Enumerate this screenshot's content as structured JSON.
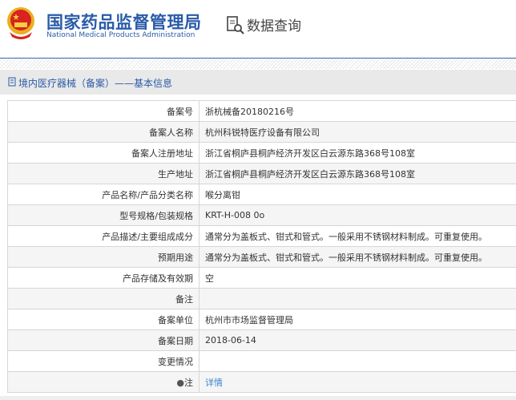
{
  "header": {
    "title_cn": "国家药品监督管理局",
    "title_en": "National Medical Products Administration",
    "data_query": "数据查询",
    "accent": "#2a5ba8"
  },
  "breadcrumb": "境内医疗器械（备案）——基本信息",
  "rows": [
    {
      "label": "备案号",
      "value": "浙杭械备20180216号"
    },
    {
      "label": "备案人名称",
      "value": "杭州科锐特医疗设备有限公司"
    },
    {
      "label": "备案人注册地址",
      "value": "浙江省桐庐县桐庐经济开发区白云源东路368号108室"
    },
    {
      "label": "生产地址",
      "value": "浙江省桐庐县桐庐经济开发区白云源东路368号108室"
    },
    {
      "label": "产品名称/产品分类名称",
      "value": "喉分离钳"
    },
    {
      "label": "型号规格/包装规格",
      "value": "KRT-H-008 0o"
    },
    {
      "label": "产品描述/主要组成成分",
      "value": "通常分为盖板式、钳式和管式。一般采用不锈钢材料制成。可重复使用。"
    },
    {
      "label": "预期用途",
      "value": "通常分为盖板式、钳式和管式。一般采用不锈钢材料制成。可重复使用。"
    },
    {
      "label": "产品存储及有效期",
      "value": "空"
    },
    {
      "label": "备注",
      "value": ""
    },
    {
      "label": "备案单位",
      "value": "杭州市市场监督管理局"
    },
    {
      "label": "备案日期",
      "value": "2018-06-14"
    },
    {
      "label": "变更情况",
      "value": ""
    }
  ],
  "note": {
    "label": "注",
    "link": "详情"
  }
}
